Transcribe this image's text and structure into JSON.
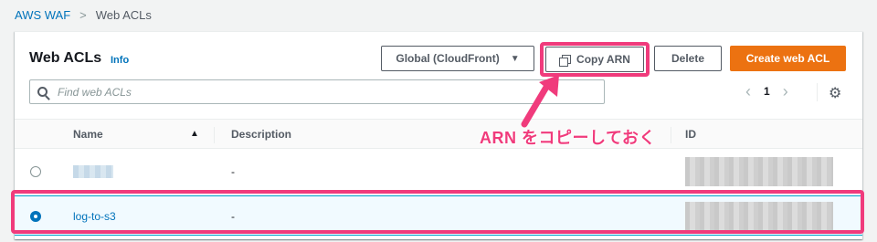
{
  "breadcrumb": {
    "root": "AWS WAF",
    "separator": ">",
    "current": "Web ACLs"
  },
  "panel": {
    "title": "Web ACLs",
    "info_link": "Info"
  },
  "toolbar": {
    "region_select": {
      "value": "Global (CloudFront)",
      "icon": "caret-down-icon"
    },
    "copy_arn_label": "Copy ARN",
    "copy_icon": "copy-icon",
    "delete_label": "Delete",
    "create_label": "Create web ACL"
  },
  "search": {
    "placeholder": "Find web ACLs",
    "value": ""
  },
  "pagination": {
    "current_page": "1",
    "prev_icon": "chevron-left-icon",
    "next_icon": "chevron-right-icon",
    "settings_icon": "gear-icon"
  },
  "table": {
    "columns": [
      "Name",
      "Description",
      "ID"
    ],
    "sort_indicator": "▲",
    "rows": [
      {
        "name": "",
        "description": "-",
        "id": "",
        "selected": false,
        "redacted": true
      },
      {
        "name": "log-to-s3",
        "description": "-",
        "id": "",
        "selected": true,
        "redacted_id": true
      }
    ]
  },
  "annotation": {
    "text": "ARN をコピーしておく",
    "color": "#f03b7c"
  },
  "colors": {
    "accent_link": "#0073bb",
    "primary_button": "#ec7211",
    "highlight": "#f03b7c",
    "selected_row_bg": "#f1faff"
  }
}
